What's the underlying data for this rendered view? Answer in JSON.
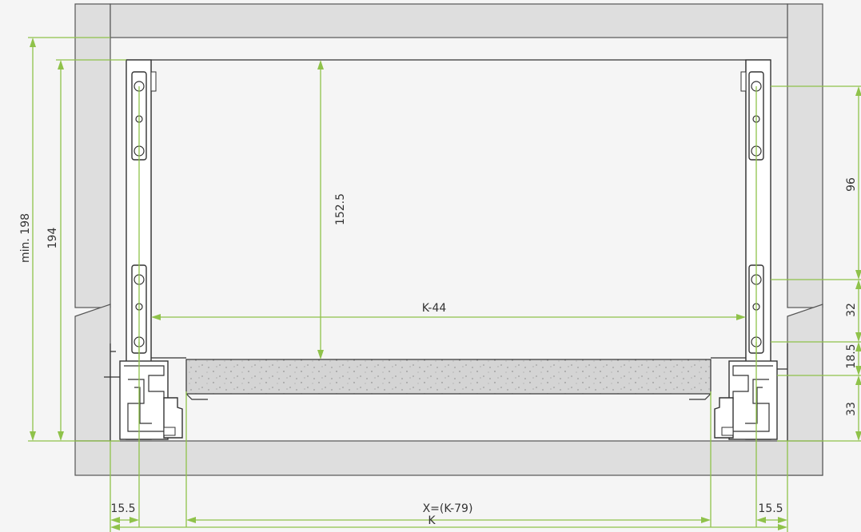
{
  "colors": {
    "background": "#f5f5f5",
    "panel_fill": "#dedede",
    "outline": "#555555",
    "dimension_lines": "#8fc24a",
    "drawer_bottom": "#d2d2d2"
  },
  "dimensions": {
    "min_198": "min. 198",
    "h_194": "194",
    "h_152_5": "152.5",
    "w_k_44": "K-44",
    "h_96": "96",
    "h_32": "32",
    "h_18_5": "18.5",
    "h_33": "33",
    "w_15_5_left": "15.5",
    "w_x": "X=(K-79)",
    "w_15_5_right": "15.5",
    "w_k": "K"
  }
}
